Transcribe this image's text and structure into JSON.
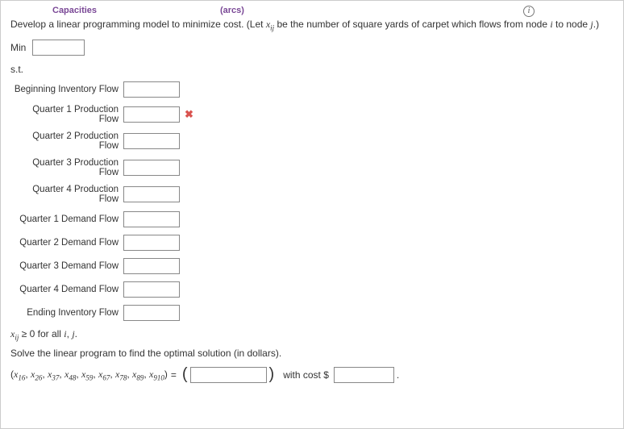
{
  "header": {
    "left": "Capacities",
    "mid": "(arcs)"
  },
  "prompt": {
    "part1": "Develop a linear programming model to minimize cost. (Let ",
    "var": "x",
    "subvar": "ij",
    "part2": " be the number of square yards of carpet which flows from node ",
    "ivar": "i",
    "part3": " to node ",
    "jvar": "j",
    "part4": ".)"
  },
  "labels": {
    "min": "Min",
    "st": "s.t.",
    "constraints": [
      "Beginning Inventory Flow",
      "Quarter 1 Production Flow",
      "Quarter 2 Production Flow",
      "Quarter 3 Production Flow",
      "Quarter 4 Production Flow",
      "Quarter 1 Demand Flow",
      "Quarter 2 Demand Flow",
      "Quarter 3 Demand Flow",
      "Quarter 4 Demand Flow",
      "Ending Inventory Flow"
    ]
  },
  "nonneg": {
    "var": "x",
    "sub": "ij",
    "text1": " ≥ 0 for all ",
    "i": "i",
    "comma": ", ",
    "j": "j",
    "period": "."
  },
  "solve_text": "Solve the linear program to find the optimal solution (in dollars).",
  "solution": {
    "open": "(",
    "var": "x",
    "subs": [
      "16",
      "26",
      "37",
      "48",
      "59",
      "67",
      "78",
      "89",
      "910"
    ],
    "sep": ", ",
    "close": ")",
    "eq": " = ",
    "withcost": "with cost $",
    "period": "."
  }
}
